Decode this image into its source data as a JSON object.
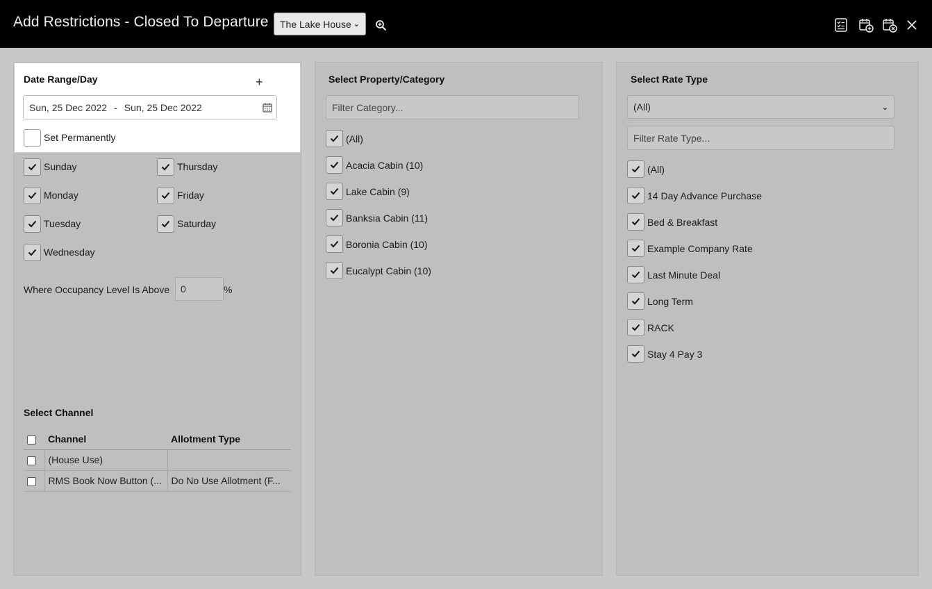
{
  "header": {
    "title": "Add Restrictions - Closed To Departure",
    "property_select": "The Lake House"
  },
  "date_panel": {
    "heading": "Date Range/Day",
    "date_from": "Sun, 25 Dec 2022",
    "date_separator": "-",
    "date_to": "Sun, 25 Dec 2022",
    "set_permanently": "Set Permanently",
    "days": {
      "sunday": "Sunday",
      "monday": "Monday",
      "tuesday": "Tuesday",
      "wednesday": "Wednesday",
      "thursday": "Thursday",
      "friday": "Friday",
      "saturday": "Saturday"
    },
    "occupancy_label": "Where Occupancy Level Is Above",
    "occupancy_value": "0",
    "occupancy_unit": "%"
  },
  "channel_panel": {
    "heading": "Select Channel",
    "columns": [
      "Channel",
      "Allotment Type"
    ],
    "rows": [
      {
        "channel": "(House Use)",
        "allotment": ""
      },
      {
        "channel": "RMS Book Now Button (...",
        "allotment": "Do No Use Allotment (F..."
      }
    ]
  },
  "category_panel": {
    "heading": "Select Property/Category",
    "filter_placeholder": "Filter Category...",
    "items": [
      "(All)",
      "Acacia Cabin (10)",
      "Lake Cabin (9)",
      "Banksia Cabin (11)",
      "Boronia Cabin (10)",
      "Eucalypt Cabin (10)"
    ]
  },
  "rate_panel": {
    "heading": "Select Rate Type",
    "select_value": "(All)",
    "filter_placeholder": "Filter Rate Type...",
    "items": [
      "(All)",
      "14 Day Advance Purchase",
      "Bed & Breakfast",
      "Example Company Rate",
      "Last Minute Deal",
      "Long Term",
      "RACK",
      "Stay 4 Pay 3"
    ]
  }
}
